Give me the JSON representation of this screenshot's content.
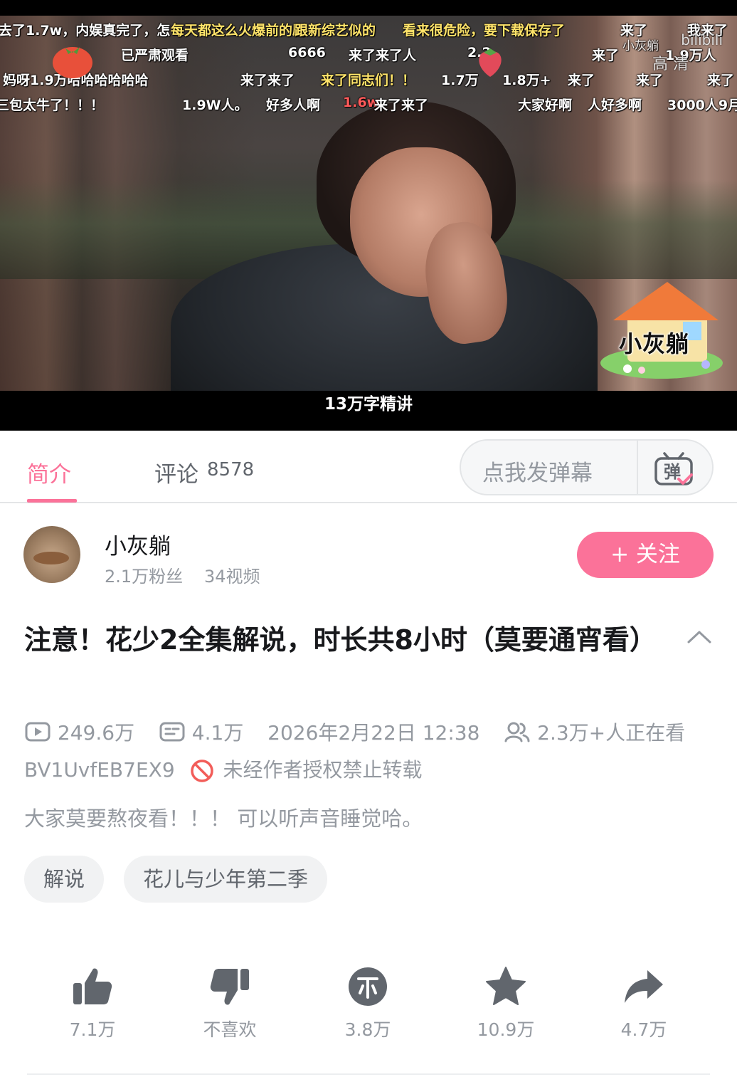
{
  "video": {
    "subtitle": "13万字精讲",
    "logo_text": "小灰躺",
    "watermark_brand": "bilibili",
    "watermark_user": "小灰躺",
    "watermark_quality": "高 清",
    "danmaku": [
      {
        "text": "去了1.7w，内娱真完了，怎",
        "color": "white"
      },
      {
        "text": "每天都这么火爆前的剧",
        "color": "yellow"
      },
      {
        "text": "跟新综艺似的",
        "color": "yellow"
      },
      {
        "text": "看来很危险，要下载保存了",
        "color": "yellow"
      },
      {
        "text": "来了",
        "color": "white"
      },
      {
        "text": "我来了",
        "color": "white"
      },
      {
        "text": "已严肃观看",
        "color": "white"
      },
      {
        "text": "6666",
        "color": "white"
      },
      {
        "text": "来了来了人",
        "color": "white"
      },
      {
        "text": "2.2",
        "color": "white"
      },
      {
        "text": "来了",
        "color": "white"
      },
      {
        "text": "1.9万人",
        "color": "white"
      },
      {
        "text": "妈呀1.9万哈哈哈哈哈哈",
        "color": "white"
      },
      {
        "text": "来了来了",
        "color": "white"
      },
      {
        "text": "来了同志们！！",
        "color": "yellow"
      },
      {
        "text": "1.7万",
        "color": "white"
      },
      {
        "text": "1.8万+",
        "color": "white"
      },
      {
        "text": "来了",
        "color": "white"
      },
      {
        "text": "来了",
        "color": "white"
      },
      {
        "text": "来了",
        "color": "white"
      },
      {
        "text": "三包太牛了！！！",
        "color": "white"
      },
      {
        "text": "1.9W人。",
        "color": "white"
      },
      {
        "text": "好多人啊",
        "color": "white"
      },
      {
        "text": "1.6w",
        "color": "red"
      },
      {
        "text": "来了来了",
        "color": "white"
      },
      {
        "text": "大家好啊",
        "color": "white"
      },
      {
        "text": "人好多啊",
        "color": "white"
      },
      {
        "text": "3000人9月",
        "color": "white"
      }
    ]
  },
  "tabs": {
    "intro_label": "简介",
    "comment_label": "评论",
    "comment_count": "8578",
    "danmaku_placeholder": "点我发弹幕",
    "danmaku_icon_char": "弹"
  },
  "uploader": {
    "name": "小灰躺",
    "fans": "2.1万粉丝",
    "videos": "34视频",
    "follow_label": "+ 关注"
  },
  "video_info": {
    "title": "注意！花少2全集解说，时长共8小时（莫要通宵看）",
    "views": "249.6万",
    "danmaku_count": "4.1万",
    "publish_time": "2026年2月22日 12:38",
    "watching_now": "2.3万+人正在看",
    "bvid": "BV1UvfEB7EX9",
    "copyright_notice": "未经作者授权禁止转载",
    "description": "大家莫要熬夜看！！！ 可以听声音睡觉哈。",
    "tags": [
      "解说",
      "花儿与少年第二季"
    ]
  },
  "actions": {
    "like": "7.1万",
    "dislike": "不喜欢",
    "coin": "3.8万",
    "favorite": "10.9万",
    "share": "4.7万"
  },
  "colors": {
    "accent": "#fb7299",
    "text_primary": "#18191c",
    "text_secondary": "#9499a0",
    "icon_gray": "#61666d",
    "danmaku_yellow": "#ffe46a",
    "danmaku_red": "#ff5a5a",
    "warning_red": "#f25d59"
  }
}
